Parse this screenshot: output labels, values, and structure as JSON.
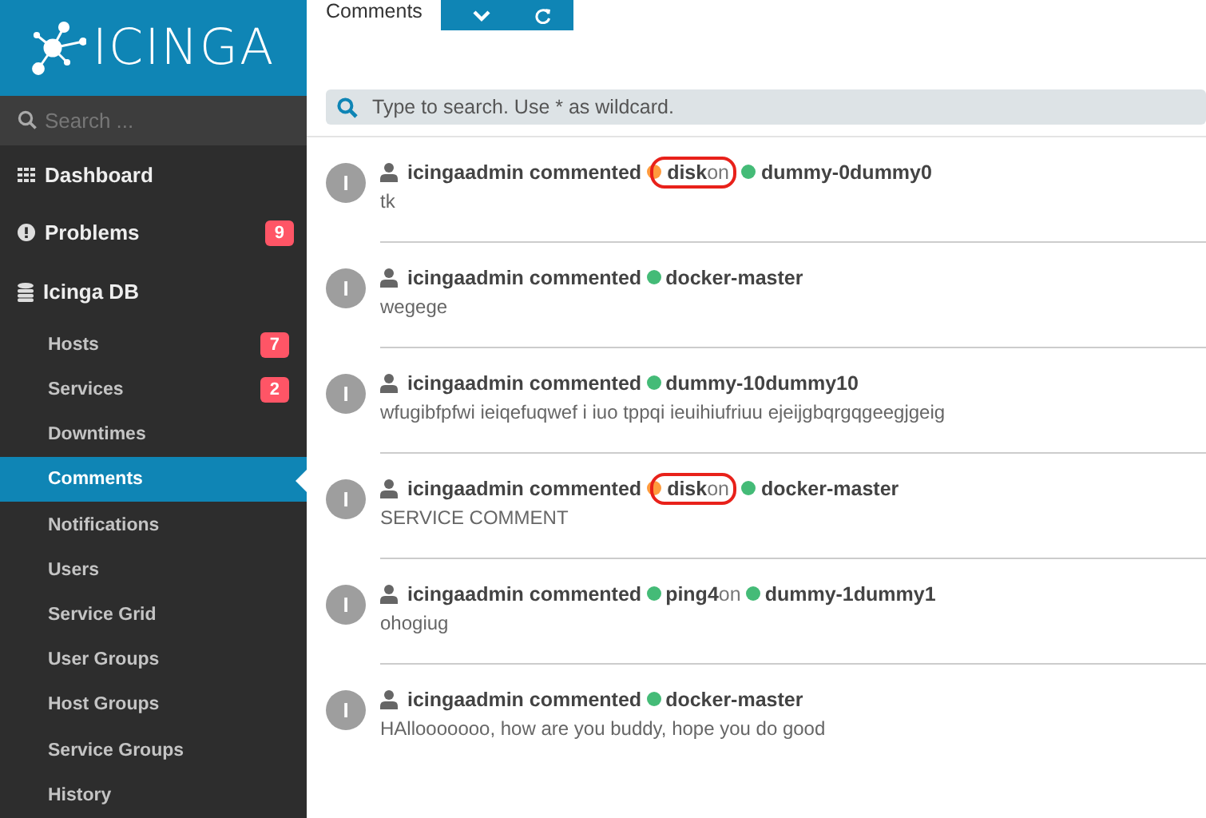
{
  "sidebar": {
    "logo": "ICINGA",
    "search": {
      "placeholder": "Search ..."
    },
    "items": [
      {
        "label": "Dashboard",
        "selected": false
      },
      {
        "label": "Problems",
        "badge": "9",
        "selected": false
      },
      {
        "label": "Icinga DB",
        "selected": false,
        "children": [
          {
            "label": "Hosts",
            "badge": "7",
            "selected": false
          },
          {
            "label": "Services",
            "badge": "2",
            "selected": false
          },
          {
            "label": "Downtimes",
            "selected": false
          },
          {
            "label": "Comments",
            "selected": true
          },
          {
            "label": "Notifications",
            "selected": false
          },
          {
            "label": "Users",
            "selected": false
          },
          {
            "label": "Service Grid",
            "selected": false
          },
          {
            "label": "User Groups",
            "selected": false
          },
          {
            "label": "Host Groups",
            "selected": false
          },
          {
            "label": "Service Groups",
            "selected": false
          },
          {
            "label": "History",
            "selected": false
          }
        ]
      }
    ]
  },
  "tabs": [
    {
      "label": "Comments",
      "selected": true
    }
  ],
  "search": {
    "placeholder": "Type to search. Use * as wildcard."
  },
  "comments": [
    {
      "avatar": "I",
      "author": "icingaadmin commented",
      "service": {
        "name": "disk",
        "color": "#ff9b3d",
        "on": "on"
      },
      "host": {
        "name": "dummy-0dummy0",
        "color": "#44bb77"
      },
      "highlighted": true,
      "text": "tk"
    },
    {
      "avatar": "I",
      "author": "icingaadmin commented",
      "host": {
        "name": "docker-master",
        "color": "#44bb77"
      },
      "highlighted": false,
      "text": "wegege"
    },
    {
      "avatar": "I",
      "author": "icingaadmin commented",
      "host": {
        "name": "dummy-10dummy10",
        "color": "#44bb77"
      },
      "highlighted": false,
      "text": "wfugibfpfwi ieiqefuqwef i iuo tppqi ieuihiufriuu ejeijgbqrgqgeegjgeig"
    },
    {
      "avatar": "I",
      "author": "icingaadmin commented",
      "service": {
        "name": "disk",
        "color": "#ff9b3d",
        "on": "on"
      },
      "host": {
        "name": "docker-master",
        "color": "#44bb77"
      },
      "highlighted": true,
      "text": "SERVICE COMMENT"
    },
    {
      "avatar": "I",
      "author": "icingaadmin commented",
      "service": {
        "name": "ping4",
        "color": "#44bb77",
        "on": "on"
      },
      "host": {
        "name": "dummy-1dummy1",
        "color": "#44bb77"
      },
      "highlighted": false,
      "text": "ohogiug"
    },
    {
      "avatar": "I",
      "author": "icingaadmin commented",
      "host": {
        "name": "docker-master",
        "color": "#44bb77"
      },
      "highlighted": false,
      "text": "HAllooooooo, how are you buddy, hope you do good"
    }
  ]
}
